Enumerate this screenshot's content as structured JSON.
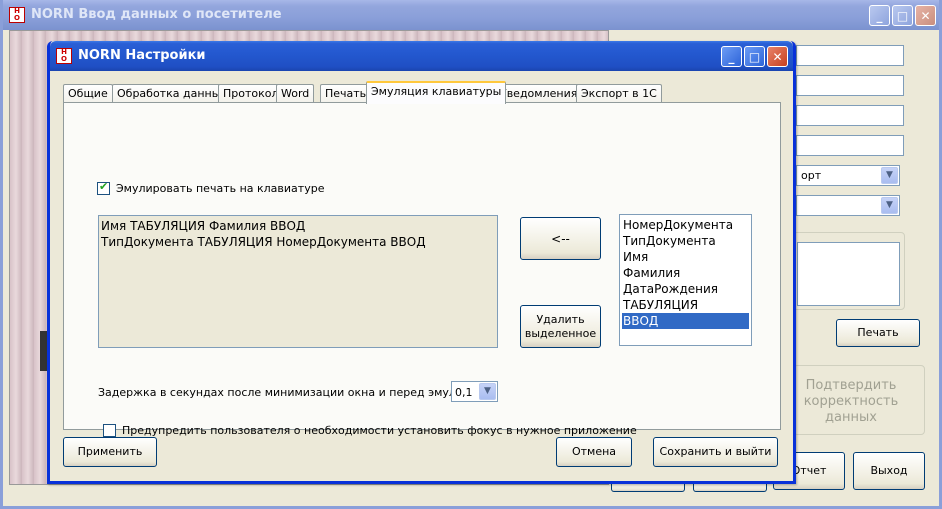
{
  "background_window": {
    "title": "NORN Ввод данных о посетителе",
    "select1_value": "орт",
    "print_button": "Печать",
    "confirm_button": "Подтвердить корректность данных",
    "report_button": "Отчет",
    "exit_button": "Выход"
  },
  "dialog": {
    "title": "NORN Настройки",
    "tabs": [
      "Общие",
      "Обработка данных",
      "Протокол",
      "Word",
      "Печать",
      "Эмуляция клавиатуры",
      "Уведомления",
      "Экспорт в 1С"
    ],
    "active_tab": "Эмуляция клавиатуры",
    "emulate_checkbox_label": "Эмулировать печать на клавиатуре",
    "emulate_checked": true,
    "sequence_text": "Имя ТАБУЛЯЦИЯ Фамилия ВВОД\nТипДокумента ТАБУЛЯЦИЯ НомерДокумента ВВОД",
    "add_button": "<--",
    "delete_button": "Удалить выделенное",
    "fields_list": [
      "НомерДокумента",
      "ТипДокумента",
      "Имя",
      "Фамилия",
      "ДатаРождения",
      "ТАБУЛЯЦИЯ",
      "ВВОД"
    ],
    "selected_field": "ВВОД",
    "delay_label": "Задержка в секундах после минимизации окна и перед эмуляцией",
    "delay_value": "0,1",
    "warn_checkbox_label": "Предупредить пользователя о необходимости установить фокус в нужное приложение",
    "warn_checked": false,
    "apply_button": "Применить",
    "cancel_button": "Отмена",
    "save_exit_button": "Сохранить и выйти"
  },
  "window_buttons": {
    "minimize": "_",
    "maximize": "□",
    "close": "✕"
  },
  "icons": {
    "app": "app-logo-icon",
    "dropdown": "chevron-down-icon",
    "check": "checkmark-icon"
  },
  "colors": {
    "title_active": "#2459d0",
    "title_inactive": "#8a9fd9",
    "selection": "#316ac5",
    "active_tab_accent": "#ffc83c"
  }
}
